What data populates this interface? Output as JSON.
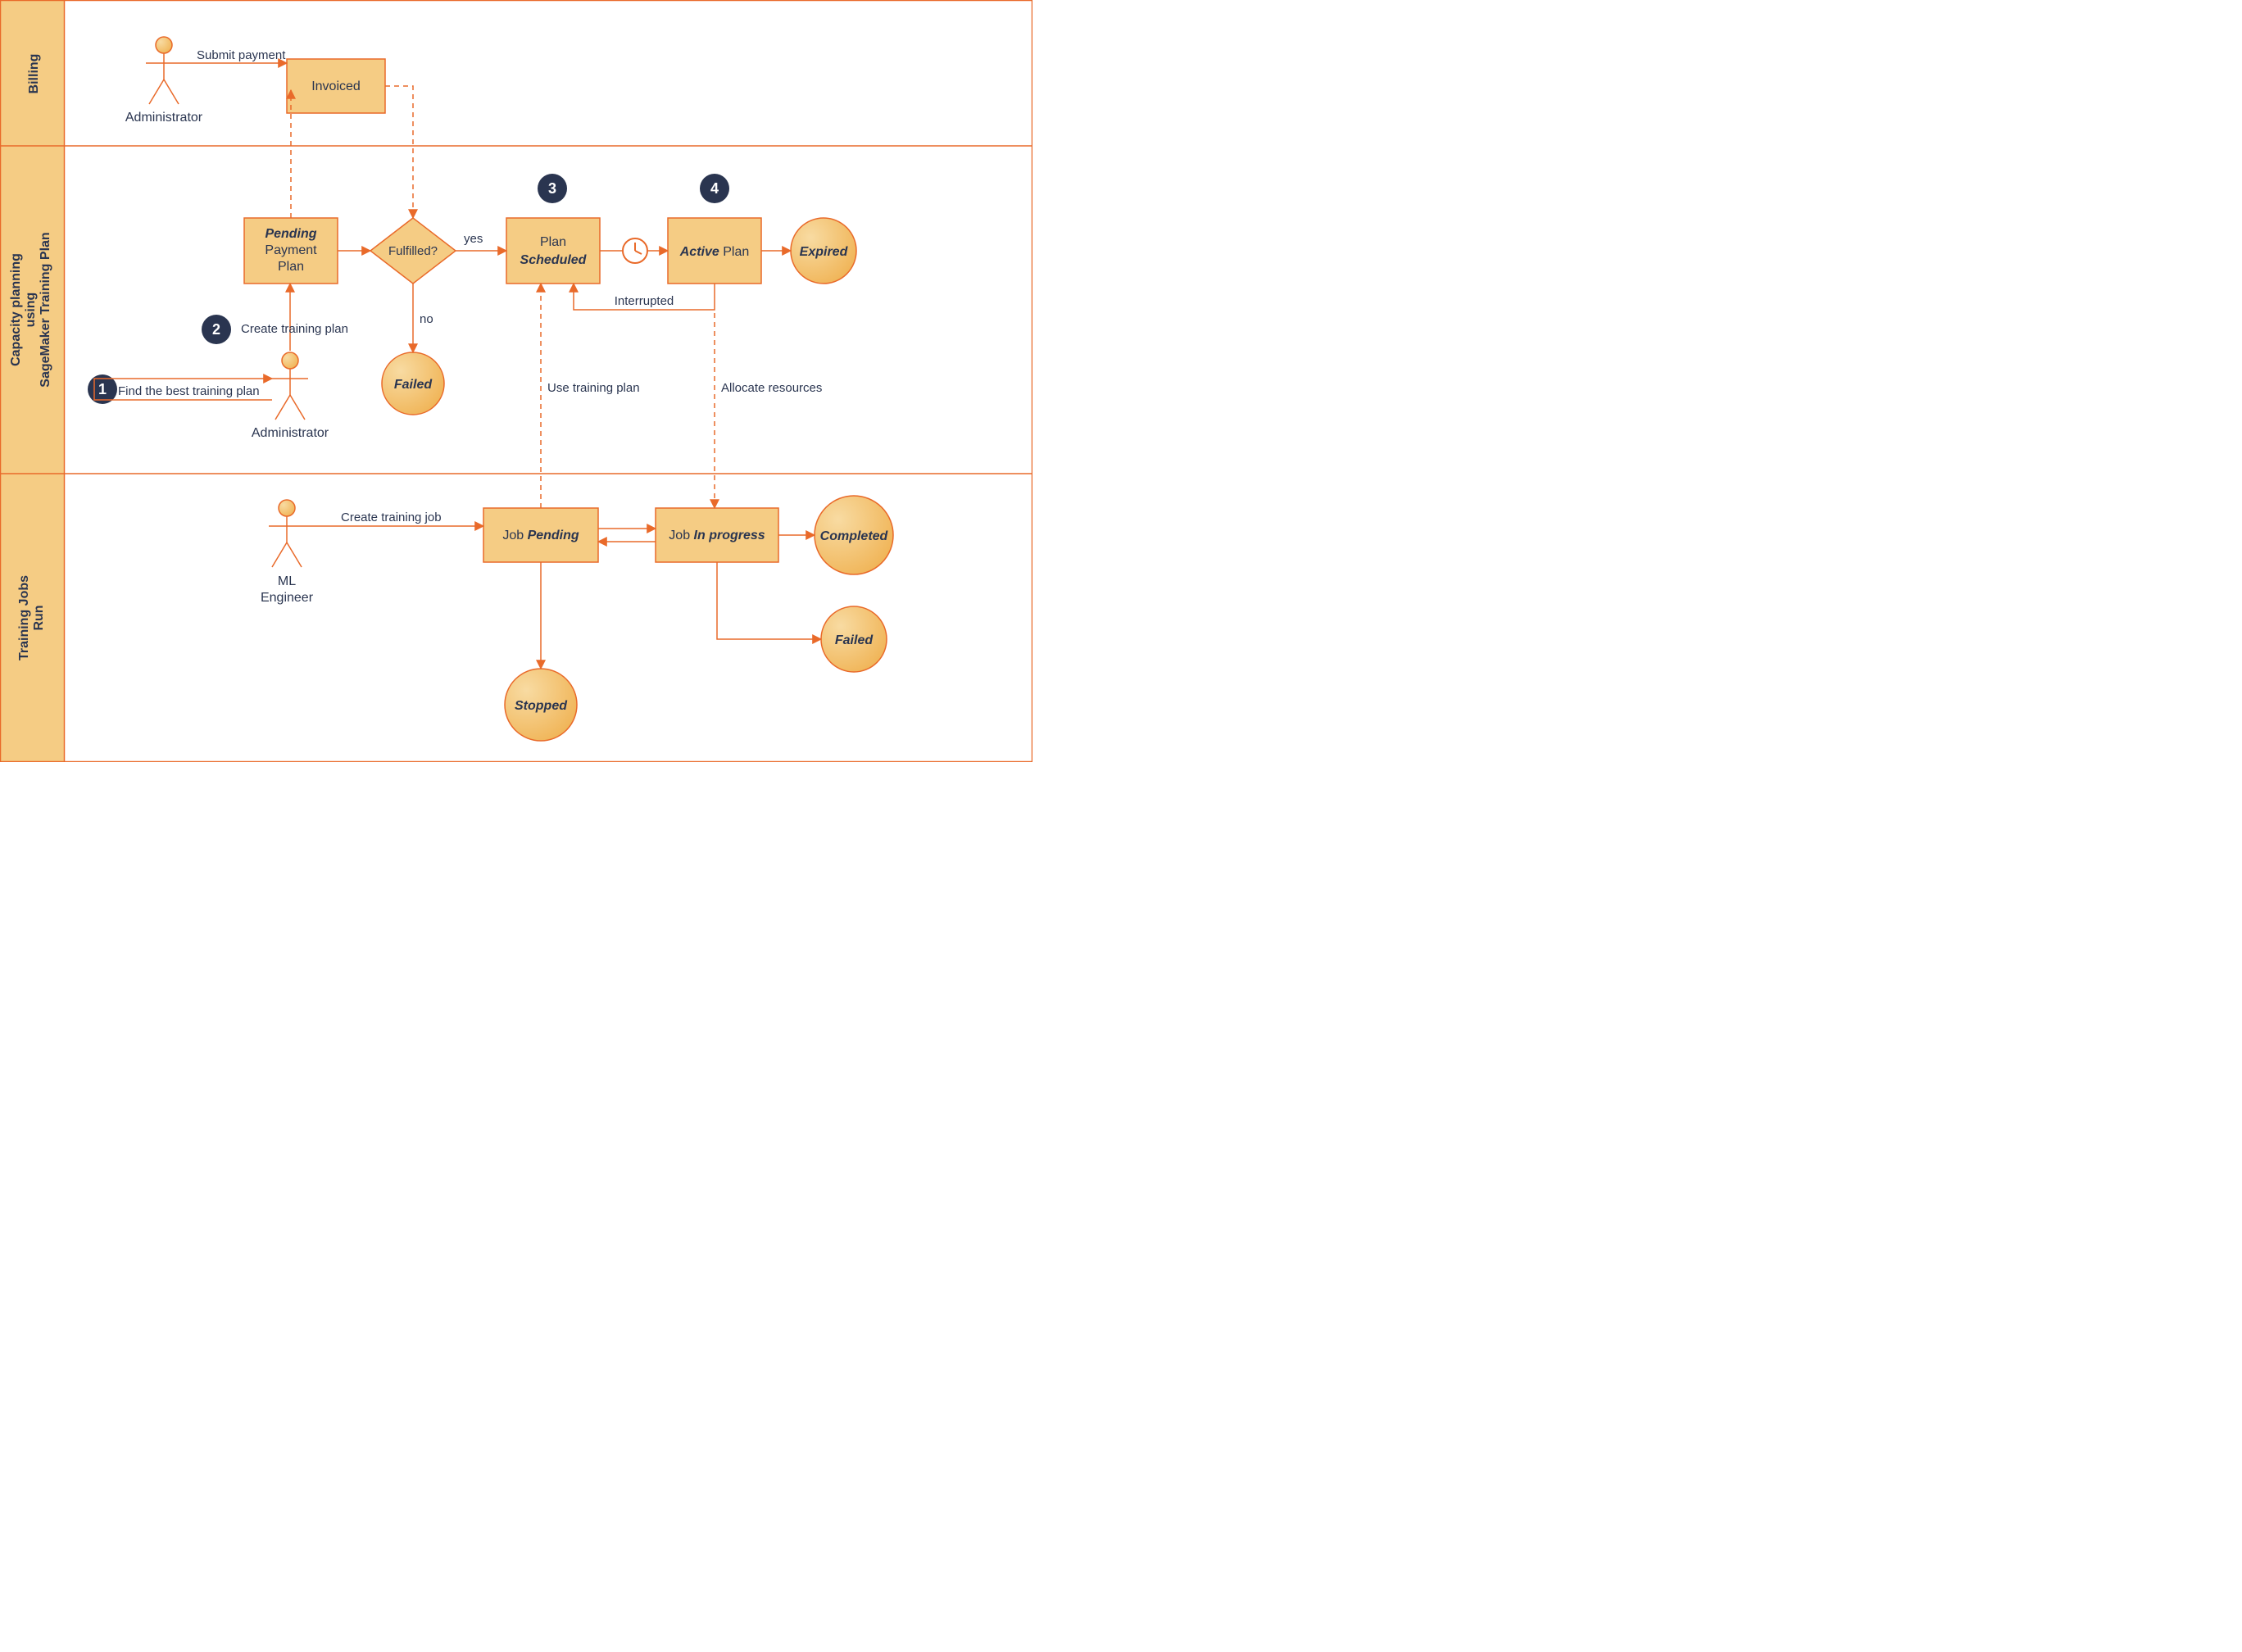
{
  "lanes": {
    "billing": "Billing",
    "capacity_l1": "Capacity planning",
    "capacity_l2": "using",
    "capacity_l3": "SageMaker Training Plan",
    "jobs_l1": "Training Jobs",
    "jobs_l2": "Run"
  },
  "actors": {
    "admin1": "Administrator",
    "admin2": "Administrator",
    "ml": "ML",
    "eng": "Engineer"
  },
  "nodes": {
    "invoiced": "Invoiced",
    "pending_l1": "Pending",
    "pending_l2": "Payment",
    "pending_l3": "Plan",
    "fulfilled": "Fulfilled?",
    "plan_l1": "Plan",
    "plan_l2": "Scheduled",
    "active_l1": "Active",
    "active_l2": " Plan",
    "expired": "Expired",
    "failed": "Failed",
    "jobpending_l1": "Job ",
    "jobpending_l2": "Pending",
    "jobprog_l1": "Job ",
    "jobprog_l2": "In progress",
    "completed": "Completed",
    "jobfailed": "Failed",
    "stopped": "Stopped"
  },
  "edges": {
    "submit": "Submit payment",
    "create_plan": "Create training plan",
    "find_plan": "Find the best training plan",
    "yes": "yes",
    "no": "no",
    "interrupted": "Interrupted",
    "use_plan": "Use training plan",
    "alloc": "Allocate resources",
    "create_job": "Create training job"
  },
  "steps": {
    "s1": "1",
    "s2": "2",
    "s3": "3",
    "s4": "4"
  }
}
